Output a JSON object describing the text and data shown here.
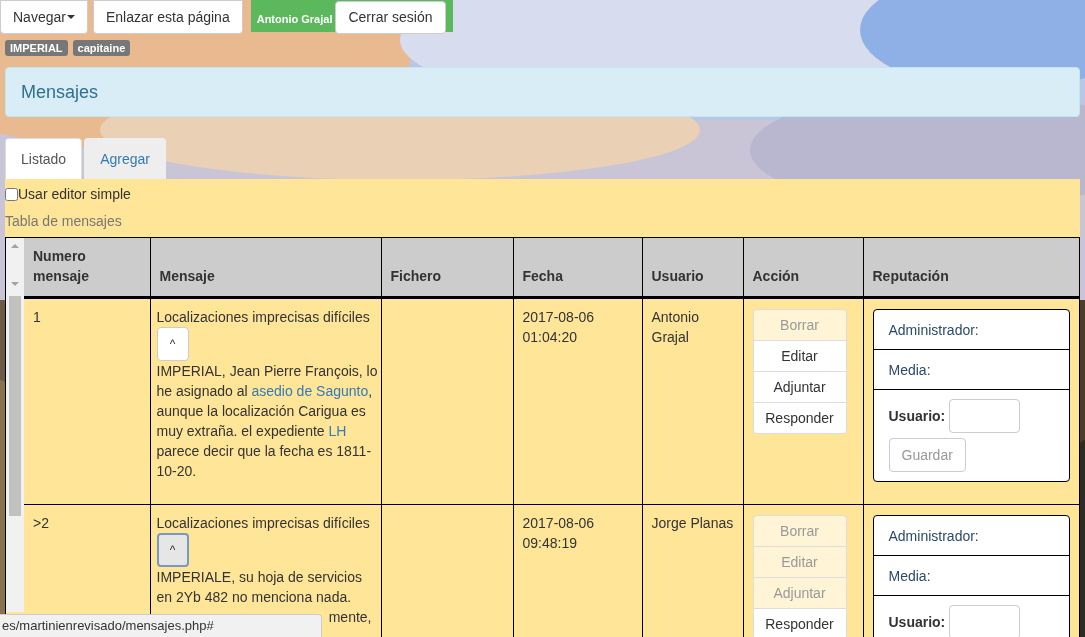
{
  "nav": {
    "buttons": [
      {
        "label": "Navegar",
        "caret": true
      },
      {
        "label": "Enlazar esta página",
        "caret": false
      }
    ],
    "user": {
      "name": "Antonio Grajal",
      "logout": "Cerrar sesión"
    }
  },
  "badges": [
    "IMPERIAL",
    "capitaine"
  ],
  "panel": {
    "title": "Mensajes"
  },
  "tabs": [
    {
      "label": "Listado",
      "selected": true
    },
    {
      "label": "Agregar",
      "selected": false
    }
  ],
  "simple_editor": {
    "label": "Usar editor simple",
    "checked": false
  },
  "table": {
    "caption": "Tabla de mensajes",
    "columns": [
      "Numero mensaje",
      "Mensaje",
      "Fichero",
      "Fecha",
      "Usuario",
      "Acción",
      "Reputación"
    ],
    "rows": [
      {
        "number": "1",
        "subject": "Localizaciones imprecisas difíciles",
        "toggle": {
          "label": "^",
          "focused": false
        },
        "body": [
          {
            "text": "IMPERIAL, Jean Pierre François, lo he asignado al ",
            "link": false
          },
          {
            "text": "asedio de Sagunto",
            "link": true
          },
          {
            "text": ", aunque la localización Carigua es muy extraña. el expediente ",
            "link": false
          },
          {
            "text": "LH",
            "link": true
          },
          {
            "text": " parece decir que la fecha es 1811-10-20.",
            "link": false
          }
        ],
        "date": "2017-08-06 01:04:20",
        "user": "Antonio Grajal",
        "actions": [
          {
            "label": "Borrar",
            "disabled": true
          },
          {
            "label": "Editar",
            "disabled": false
          },
          {
            "label": "Adjuntar",
            "disabled": false
          },
          {
            "label": "Responder",
            "disabled": false
          }
        ],
        "reputation": {
          "admin": "Administrador:",
          "media": "Media:",
          "user": "Usuario:",
          "save": "Guardar"
        }
      },
      {
        "number": ">2",
        "subject": "Localizaciones imprecisas difíciles",
        "toggle": {
          "label": "^",
          "focused": true
        },
        "body": [
          {
            "text": "IMPERIALE, su hoja de servicios en 2Yb 482 no menciona nada.",
            "link": false
          }
        ],
        "continuation": "mente,",
        "date": "2017-08-06 09:48:19",
        "user": "Jorge Planas",
        "actions": [
          {
            "label": "Borrar",
            "disabled": true
          },
          {
            "label": "Editar",
            "disabled": true
          },
          {
            "label": "Adjuntar",
            "disabled": true
          },
          {
            "label": "Responder",
            "disabled": false
          }
        ],
        "reputation": {
          "admin": "Administrador:",
          "media": "Media:",
          "user": "Usuario:"
        }
      }
    ]
  },
  "status_bar": {
    "url": "es/martinienrevisado/mensajes.php#"
  }
}
